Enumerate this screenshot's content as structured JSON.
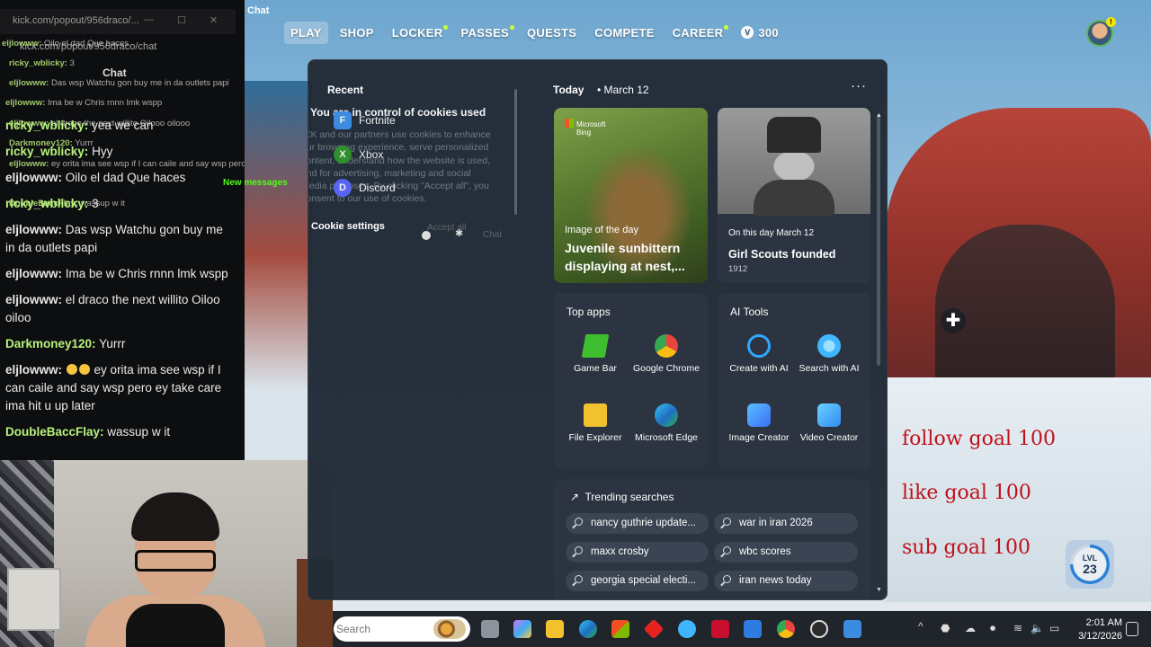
{
  "game": {
    "chat_title": "Chat",
    "nav": [
      {
        "label": "PLAY",
        "active": true,
        "dot": false
      },
      {
        "label": "SHOP",
        "active": false,
        "dot": false
      },
      {
        "label": "LOCKER",
        "active": false,
        "dot": true
      },
      {
        "label": "PASSES",
        "active": false,
        "dot": true
      },
      {
        "label": "QUESTS",
        "active": false,
        "dot": false
      },
      {
        "label": "COMPETE",
        "active": false,
        "dot": false
      },
      {
        "label": "CAREER",
        "active": false,
        "dot": true
      }
    ],
    "vbucks_icon": "V",
    "vbucks": "300",
    "profile_badge": "!",
    "plus_marker": "✚",
    "goals": {
      "follow": "follow goal 100",
      "like": "like goal 100",
      "sub": "sub goal 100"
    },
    "level": {
      "label": "LVL",
      "value": "23",
      "progress_fraction": 0.75
    }
  },
  "chat_popout": {
    "faint_url": "kick.com/popout/956draco/...",
    "url": "kick.com/popout/956draco/chat",
    "header": "Chat",
    "new_messages": "New messages",
    "ghost_lines": [
      {
        "user": "eljlowww:",
        "text": "Oilo el dad Que haces"
      },
      {
        "user": "ricky_wblicky:",
        "text": "3"
      },
      {
        "user": "eljlowww:",
        "text": "Das wsp Watchu gon buy me in da outlets papi"
      },
      {
        "user": "eljlowww:",
        "text": "Ima be w Chris rnnn lmk wspp"
      },
      {
        "user": "eljlowww:",
        "text": "el draco the next willito Oilooo oilooo"
      },
      {
        "user": "Darkmoney120:",
        "text": "Yurrr"
      },
      {
        "user": "eljlowww:",
        "text": "ey orita ima see wsp if I can caile and say wsp pero ey take care ima hit u up later"
      },
      {
        "user": "DoubleBaccFlay:",
        "text": "wassup w it"
      }
    ],
    "messages": [
      {
        "user": "ricky_wblicky:",
        "text": "yea we can"
      },
      {
        "user": "ricky_wblicky:",
        "text": "Hyy"
      },
      {
        "user": "eljlowww:",
        "text": "Oilo el dad Que haces"
      },
      {
        "user": "ricky_wblicky:",
        "text": "3"
      },
      {
        "user": "eljlowww:",
        "text": "Das wsp Watchu gon buy me in da outlets papi"
      },
      {
        "user": "eljlowww:",
        "text": "Ima be w Chris rnnn lmk wspp"
      },
      {
        "user": "eljlowww:",
        "text": "el draco the next willito Oiloo oiloo"
      },
      {
        "user": "Darkmoney120:",
        "text": "Yurrr"
      },
      {
        "user": "eljlowww:",
        "text": "ey orita ima see wsp if I can caile and say wsp pero ey take care ima hit u up later"
      },
      {
        "user": "DoubleBaccFlay:",
        "text": "wassup w it"
      }
    ]
  },
  "start_panel": {
    "recent_header": "Recent",
    "recent_items": [
      {
        "name": "Fortnite",
        "icon": "fortnite-icon",
        "color": "#3b8be0",
        "glyph": "F"
      },
      {
        "name": "Xbox",
        "icon": "xbox-icon",
        "color": "#2f8f2f",
        "glyph": "X"
      },
      {
        "name": "Discord",
        "icon": "discord-icon",
        "color": "#5865f2",
        "glyph": "D"
      }
    ],
    "cookie": {
      "title": "You are in control of cookies used",
      "body": "ICK and our partners use cookies to enhance our browsing experience, serve personalized content, understand how the website is used, and for advertising, marketing and social media purposes. By clicking \"Accept all\", you consent to our use of cookies.",
      "settings": "Cookie settings",
      "accept": "Accept all",
      "chat": "Chat"
    },
    "today_label": "Today",
    "date": "March 12",
    "more": "···",
    "image_of_day": {
      "badge_line1": "Microsoft",
      "badge_line2": "Bing",
      "caption": "Image of the day",
      "title": "Juvenile sunbittern displaying at nest,..."
    },
    "on_this_day": {
      "caption": "On this day March 12",
      "title": "Girl Scouts founded",
      "year": "1912"
    },
    "top_apps": {
      "header": "Top apps",
      "apps": [
        {
          "label": "Game Bar",
          "icon": "game-bar-icon",
          "color": "#3fbf2f"
        },
        {
          "label": "Google Chrome",
          "icon": "chrome-icon",
          "color": "#e8453c"
        },
        {
          "label": "File Explorer",
          "icon": "folder-icon",
          "color": "#f2c12e"
        },
        {
          "label": "Microsoft Edge",
          "icon": "edge-icon",
          "color": "#1f9bd1"
        }
      ]
    },
    "ai_tools": {
      "header": "AI Tools",
      "apps": [
        {
          "label": "Create with AI",
          "icon": "create-ai-icon",
          "color": "#2ea8ff"
        },
        {
          "label": "Search with AI",
          "icon": "search-ai-icon",
          "color": "#3fb6ff"
        },
        {
          "label": "Image Creator",
          "icon": "image-creator-icon",
          "color": "#3a8df5"
        },
        {
          "label": "Video Creator",
          "icon": "video-creator-icon",
          "color": "#2f8df0"
        }
      ]
    },
    "trending": {
      "header": "Trending searches",
      "items": [
        "nancy guthrie update...",
        "war in iran 2026",
        "maxx crosby",
        "wbc scores",
        "georgia special electi...",
        "iran news today"
      ]
    }
  },
  "taskbar": {
    "search_placeholder": "Search",
    "icons": [
      {
        "name": "task-view-icon",
        "color": "#9aa0a8"
      },
      {
        "name": "copilot-icon",
        "color": "#c77bf0"
      },
      {
        "name": "file-explorer-icon",
        "color": "#f2c12e"
      },
      {
        "name": "edge-icon",
        "color": "#1f9bd1"
      },
      {
        "name": "store-icon",
        "color": "#3a8df5"
      },
      {
        "name": "app-red-icon",
        "color": "#e8231f"
      },
      {
        "name": "app-edge-badge-icon",
        "color": "#3fb6ff"
      },
      {
        "name": "mcafee-icon",
        "color": "#c8102e"
      },
      {
        "name": "mail-icon",
        "color": "#2f7ce0"
      },
      {
        "name": "chrome-icon",
        "color": "#e8453c"
      },
      {
        "name": "obs-icon",
        "color": "#dcdcdc"
      },
      {
        "name": "fortnite-icon",
        "color": "#3b8be0"
      }
    ],
    "tray": [
      {
        "name": "app-tray-icon",
        "glyph": "⬣"
      },
      {
        "name": "cloud-icon",
        "glyph": "☁"
      },
      {
        "name": "microphone-icon",
        "glyph": "⏺"
      },
      {
        "name": "wifi-icon",
        "glyph": "≋"
      },
      {
        "name": "volume-icon",
        "glyph": "🔈"
      },
      {
        "name": "battery-icon",
        "glyph": "▭"
      }
    ],
    "tray_chevron": "^",
    "time": "2:01 AM",
    "date": "3/12/2026"
  }
}
